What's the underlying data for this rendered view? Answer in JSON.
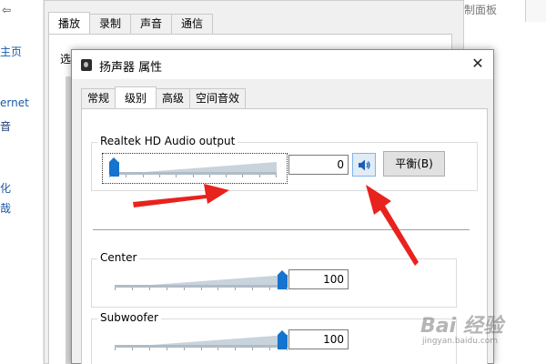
{
  "background": {
    "left_nav": [
      "主页",
      "ernet",
      "音",
      "化",
      "哉"
    ],
    "sound_dialog": {
      "tabs": [
        "播放",
        "录制",
        "声音",
        "通信"
      ],
      "active_tab_index": 0,
      "select_label_fragment": "选"
    },
    "right_title": "制面板"
  },
  "dialog": {
    "title": "扬声器 属性",
    "close_icon": "close-icon",
    "tabs": [
      "常规",
      "级别",
      "高级",
      "空间音效"
    ],
    "active_tab_index": 1,
    "main_group": {
      "label": "Realtek HD Audio output",
      "volume_value": "0",
      "volume_level": 0,
      "mute_icon": "speaker-icon",
      "balance_label": "平衡(B)"
    },
    "channels": [
      {
        "label": "Center",
        "value": "100",
        "level": 100
      },
      {
        "label": "Subwoofer",
        "value": "100",
        "level": 100
      }
    ]
  },
  "annotations": {
    "arrow_color": "#e8221d"
  },
  "watermark": {
    "text": "Bai 经验",
    "url": "jingyan.baidu.com"
  }
}
